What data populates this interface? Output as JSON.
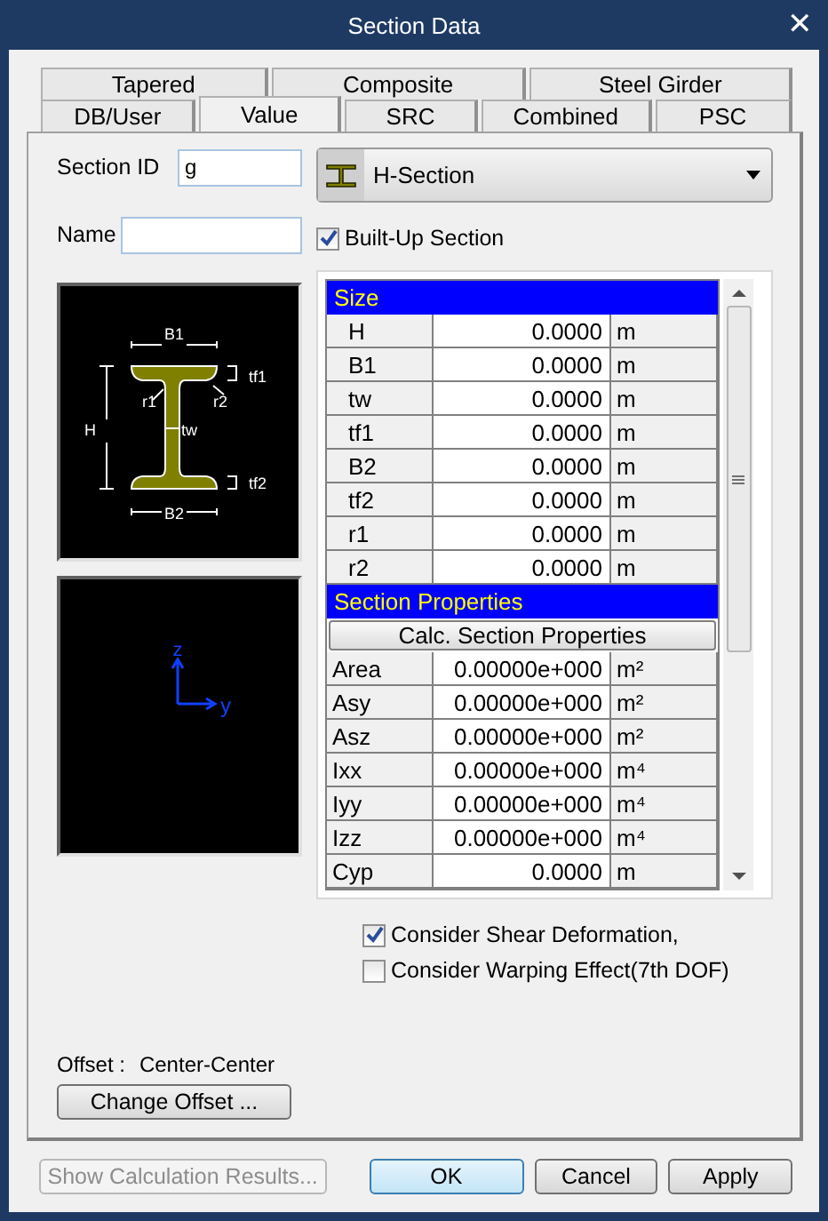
{
  "window": {
    "title": "Section Data",
    "close": "✕"
  },
  "tab_rows": [
    {
      "tabs": [
        {
          "label": "Tapered",
          "selected": false
        },
        {
          "label": "Composite",
          "selected": false
        },
        {
          "label": "Steel Girder",
          "selected": false
        }
      ]
    },
    {
      "tabs": [
        {
          "label": "DB/User",
          "selected": false
        },
        {
          "label": "Value",
          "selected": true
        },
        {
          "label": "SRC",
          "selected": false
        },
        {
          "label": "Combined",
          "selected": false
        },
        {
          "label": "PSC",
          "selected": false
        }
      ]
    }
  ],
  "section_id": {
    "label": "Section ID",
    "value": "g"
  },
  "name": {
    "label": "Name"
  },
  "section_type": {
    "value": "H-Section"
  },
  "built_up": {
    "label": "Built-Up Section",
    "checked": true
  },
  "diagram": {
    "labels": [
      "B1",
      "tf1",
      "r1",
      "r2",
      "H",
      "tw",
      "tf2",
      "B2"
    ]
  },
  "axes": {
    "labels": [
      "z",
      "y"
    ]
  },
  "table": {
    "groups": [
      {
        "title": "Size",
        "rows": [
          {
            "label": "H",
            "value": "0.0000",
            "unit": "m"
          },
          {
            "label": "B1",
            "value": "0.0000",
            "unit": "m"
          },
          {
            "label": "tw",
            "value": "0.0000",
            "unit": "m"
          },
          {
            "label": "tf1",
            "value": "0.0000",
            "unit": "m"
          },
          {
            "label": "B2",
            "value": "0.0000",
            "unit": "m"
          },
          {
            "label": "tf2",
            "value": "0.0000",
            "unit": "m"
          },
          {
            "label": "r1",
            "value": "0.0000",
            "unit": "m"
          },
          {
            "label": "r2",
            "value": "0.0000",
            "unit": "m"
          }
        ]
      },
      {
        "title": "Section Properties",
        "button": "Calc. Section Properties",
        "rows": [
          {
            "label": "Area",
            "value": "0.00000e+000",
            "unit": "m²"
          },
          {
            "label": "Asy",
            "value": "0.00000e+000",
            "unit": "m²"
          },
          {
            "label": "Asz",
            "value": "0.00000e+000",
            "unit": "m²"
          },
          {
            "label": "Ixx",
            "value": "0.00000e+000",
            "unit": "m⁴"
          },
          {
            "label": "Iyy",
            "value": "0.00000e+000",
            "unit": "m⁴"
          },
          {
            "label": "Izz",
            "value": "0.00000e+000",
            "unit": "m⁴"
          },
          {
            "label": "Cyp",
            "value": "0.0000",
            "unit": "m"
          }
        ]
      }
    ]
  },
  "options": [
    {
      "label": "Consider Shear Deformation,",
      "checked": true
    },
    {
      "label": "Consider Warping Effect(7th DOF)",
      "checked": false
    }
  ],
  "offset": {
    "label": "Offset :",
    "value": "Center-Center",
    "button": "Change Offset ..."
  },
  "buttons": [
    {
      "label": "Show Calculation Results...",
      "disabled": true,
      "default": false
    },
    {
      "label": "OK",
      "disabled": false,
      "default": true
    },
    {
      "label": "Cancel",
      "disabled": false,
      "default": false
    },
    {
      "label": "Apply",
      "disabled": false,
      "default": false
    }
  ]
}
